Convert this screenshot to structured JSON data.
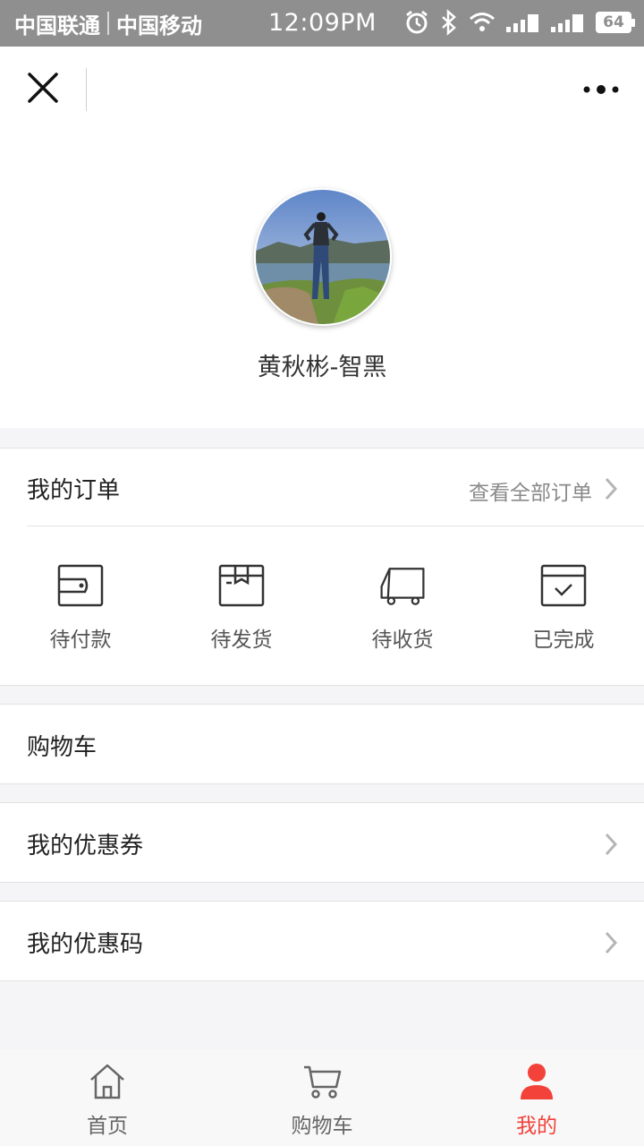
{
  "status_bar": {
    "carrier1": "中国联通",
    "carrier2": "中国移动",
    "time": "12:09PM",
    "battery": "64",
    "icons": [
      "alarm-icon",
      "bluetooth-icon",
      "wifi-icon",
      "signal-icon",
      "signal-icon",
      "battery-icon"
    ]
  },
  "header": {
    "close_icon": "close-icon",
    "more_icon": "more-dots-icon"
  },
  "profile": {
    "username": "黄秋彬-智黑"
  },
  "orders": {
    "title": "我的订单",
    "view_all": "查看全部订单",
    "items": [
      {
        "label": "待付款",
        "icon": "wallet-icon"
      },
      {
        "label": "待发货",
        "icon": "package-icon"
      },
      {
        "label": "待收货",
        "icon": "truck-icon"
      },
      {
        "label": "已完成",
        "icon": "check-box-icon"
      }
    ]
  },
  "menu": {
    "cart": "购物车",
    "coupons": "我的优惠券",
    "codes": "我的优惠码"
  },
  "tabs": [
    {
      "label": "首页",
      "icon": "home-icon",
      "active": false
    },
    {
      "label": "购物车",
      "icon": "cart-icon",
      "active": false
    },
    {
      "label": "我的",
      "icon": "user-icon",
      "active": true
    }
  ],
  "colors": {
    "accent": "#f2423a",
    "status_bar": "#8f8f8f",
    "background": "#f5f5f7"
  }
}
